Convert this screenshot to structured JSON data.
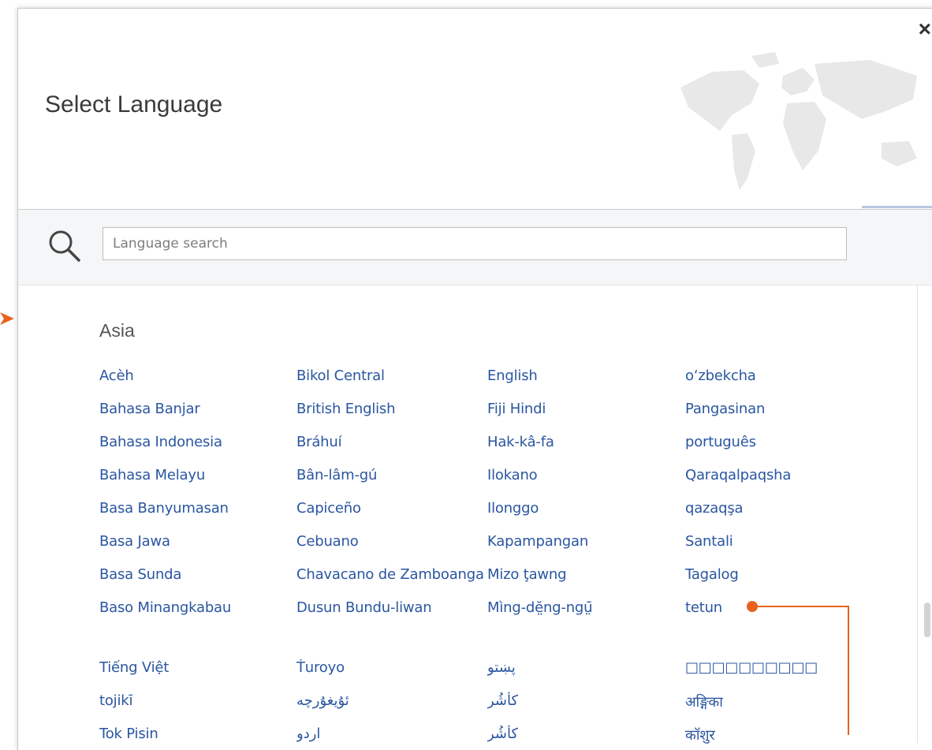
{
  "dialog": {
    "title": "Select Language",
    "close_label": "×"
  },
  "search": {
    "placeholder": "Language search",
    "value": ""
  },
  "region": {
    "name": "Asia",
    "columns": [
      [
        "Acèh",
        "Bahasa Banjar",
        "Bahasa Indonesia",
        "Bahasa Melayu",
        "Basa Banyumasan",
        "Basa Jawa",
        "Basa Sunda",
        "Baso Minangkabau",
        "Tiếng Việt",
        "tojikī",
        "Tok Pisin"
      ],
      [
        "Bikol Central",
        "British English",
        "Bráhuí",
        "Bân-lâm-gú",
        "Capiceño",
        "Cebuano",
        "Chavacano de Zamboanga",
        "Dusun Bundu-liwan",
        "Ṫuroyo",
        "ئۇيغۇرچە",
        "اردو"
      ],
      [
        "English",
        "Fiji Hindi",
        "Hak-kâ-fa",
        "Ilokano",
        "Ilonggo",
        "Kapampangan",
        "Mizo ţawng",
        "Mìng-dĕ̤ng-ngṳ̄",
        "پښتو",
        "كأشُر",
        "كأشُر"
      ],
      [
        "o‘zbekcha",
        "Pangasinan",
        "português",
        "Qaraqalpaqsha",
        "qazaqşa",
        "Santali",
        "Tagalog",
        "tetun",
        "□□□□□□□□□□",
        "अङ्गिका",
        "कॉशुर"
      ]
    ]
  },
  "colors": {
    "link": "#2a56a0",
    "annotation": "#e8621e"
  }
}
